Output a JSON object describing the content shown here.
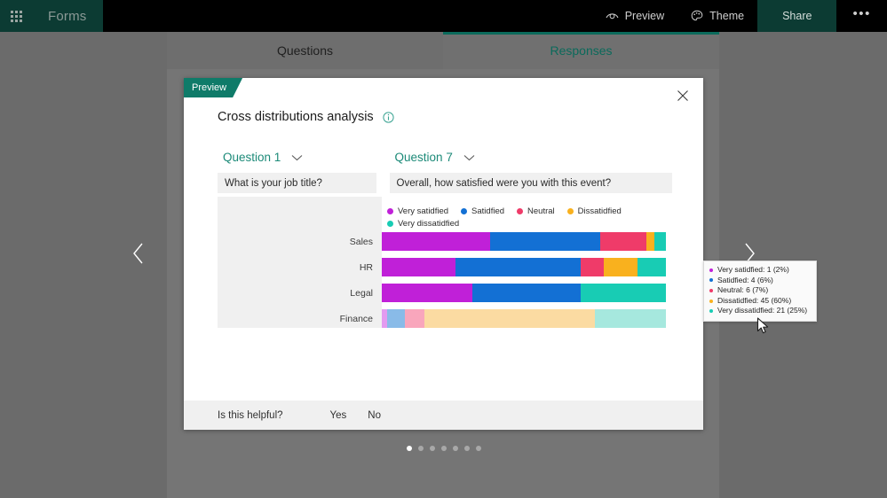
{
  "topbar": {
    "waffle_icon": "app-launcher-icon",
    "app_name": "Forms",
    "preview_label": "Preview",
    "preview_icon": "eye-icon",
    "theme_label": "Theme",
    "theme_icon": "palette-icon",
    "share_label": "Share",
    "more_label": "•••",
    "brand_color": "#0c3b33"
  },
  "tabs": [
    {
      "label": "Questions",
      "active": false
    },
    {
      "label": "Responses",
      "active": true
    }
  ],
  "carousel": {
    "prev_icon": "chevron-left-icon",
    "next_icon": "chevron-right-icon",
    "dot_count": 7,
    "active_dot": 1
  },
  "dialog": {
    "ribbon_label": "Preview",
    "close_icon": "close-icon",
    "title": "Cross distributions analysis",
    "info_icon": "info-icon",
    "question_left": {
      "selector_label": "Question 1",
      "chevron_icon": "chevron-down-icon",
      "value": "What is your job title?"
    },
    "question_right": {
      "selector_label": "Question 7",
      "chevron_icon": "chevron-down-icon",
      "value": "Overall, how satisfied were you with this event?"
    },
    "footer": {
      "helpful_label": "Is this helpful?",
      "yes_label": "Yes",
      "no_label": "No"
    }
  },
  "tooltip": {
    "lines": [
      {
        "label": "Very satidfied",
        "count": 1,
        "percent": "2%",
        "text": "Very satidfied: 1 (2%)",
        "color": "#c020d8"
      },
      {
        "label": "Satidfied",
        "count": 4,
        "percent": "6%",
        "text": "Satidfied: 4 (6%)",
        "color": "#1370d4"
      },
      {
        "label": "Neutral",
        "count": 6,
        "percent": "7%",
        "text": "Neutral: 6 (7%)",
        "color": "#ef3b69"
      },
      {
        "label": "Dissatidfied",
        "count": 45,
        "percent": "60%",
        "text": "Dissatidfied: 45 (60%)",
        "color": "#f9b11e"
      },
      {
        "label": "Very dissatidfied",
        "count": 21,
        "percent": "25%",
        "text": "Very dissatidfied: 21 (25%)",
        "color": "#18ccb4"
      }
    ]
  },
  "chart_data": {
    "type": "bar",
    "subtype": "stacked-horizontal-100",
    "title": "Cross distributions analysis",
    "xlabel": "Overall, how satisfied were you with this event?",
    "ylabel": "What is your job title?",
    "categories": [
      "Sales",
      "HR",
      "Legal",
      "Finance"
    ],
    "legend": [
      "Very satidfied",
      "Satidfied",
      "Neutral",
      "Dissatidfied",
      "Very dissatidfied"
    ],
    "legend_position": "top-left",
    "colors": [
      "#c020d8",
      "#1370d4",
      "#ef3b69",
      "#f9b11e",
      "#18ccb4"
    ],
    "colors_faded": [
      "#e39bf0",
      "#89bbe8",
      "#f9a6bc",
      "#fbdba2",
      "#a6e8de"
    ],
    "grid": false,
    "xlim": [
      0,
      100
    ],
    "highlighted_category": "Finance",
    "series": [
      {
        "name": "Very satidfied",
        "values": [
          38,
          26,
          32,
          2
        ]
      },
      {
        "name": "Satidfied",
        "values": [
          39,
          44,
          38,
          6
        ]
      },
      {
        "name": "Neutral",
        "values": [
          16,
          8,
          0,
          7
        ]
      },
      {
        "name": "Dissatidfied",
        "values": [
          3,
          12,
          0,
          60
        ]
      },
      {
        "name": "Very dissatidfied",
        "values": [
          4,
          10,
          30,
          25
        ]
      }
    ]
  }
}
